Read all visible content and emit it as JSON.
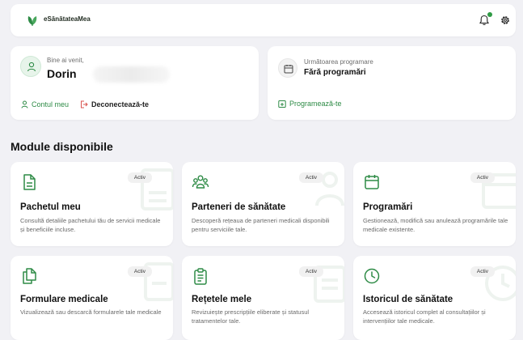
{
  "app": {
    "brand": "eSănătateaMea"
  },
  "welcome": {
    "greeting": "Bine ai venit,",
    "name": "Dorin",
    "account_link": "Contul meu",
    "logout_link": "Deconectează-te"
  },
  "appointment": {
    "label": "Următoarea programare",
    "value": "Fără programări",
    "schedule_link": "Programează-te"
  },
  "section": {
    "title": "Module disponibile"
  },
  "modules": [
    {
      "title": "Pachetul meu",
      "badge": "Activ",
      "desc": "Consultă detaliile pachetului tău de servicii medicale și beneficiile incluse.",
      "icon": "document-icon"
    },
    {
      "title": "Parteneri de sănătate",
      "badge": "Activ",
      "desc": "Descoperă rețeaua de parteneri medicali disponibili pentru serviciile tale.",
      "icon": "people-icon"
    },
    {
      "title": "Programări",
      "badge": "Activ",
      "desc": "Gestionează, modifică sau anulează programările tale medicale existente.",
      "icon": "calendar-icon"
    },
    {
      "title": "Formulare medicale",
      "badge": "Activ",
      "desc": "Vizualizează sau descarcă formularele tale medicale",
      "icon": "files-icon"
    },
    {
      "title": "Rețetele mele",
      "badge": "Activ",
      "desc": "Revizuiește prescripțiile eliberate și statusul tratamentelor tale.",
      "icon": "clipboard-icon"
    },
    {
      "title": "Istoricul de sănătate",
      "badge": "Activ",
      "desc": "Accesează istoricul complet al consultațiilor și intervențiilor tale medicale.",
      "icon": "clock-icon"
    }
  ],
  "colors": {
    "accent": "#2e8b46",
    "background": "#f1f1f5",
    "card": "#ffffff"
  }
}
